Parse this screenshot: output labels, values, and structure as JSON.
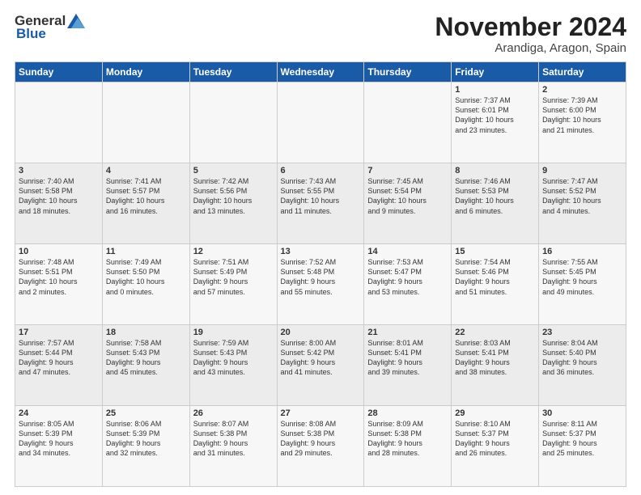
{
  "header": {
    "logo_general": "General",
    "logo_blue": "Blue",
    "month_title": "November 2024",
    "location": "Arandiga, Aragon, Spain"
  },
  "days_of_week": [
    "Sunday",
    "Monday",
    "Tuesday",
    "Wednesday",
    "Thursday",
    "Friday",
    "Saturday"
  ],
  "weeks": [
    [
      {
        "day": "",
        "info": ""
      },
      {
        "day": "",
        "info": ""
      },
      {
        "day": "",
        "info": ""
      },
      {
        "day": "",
        "info": ""
      },
      {
        "day": "",
        "info": ""
      },
      {
        "day": "1",
        "info": "Sunrise: 7:37 AM\nSunset: 6:01 PM\nDaylight: 10 hours\nand 23 minutes."
      },
      {
        "day": "2",
        "info": "Sunrise: 7:39 AM\nSunset: 6:00 PM\nDaylight: 10 hours\nand 21 minutes."
      }
    ],
    [
      {
        "day": "3",
        "info": "Sunrise: 7:40 AM\nSunset: 5:58 PM\nDaylight: 10 hours\nand 18 minutes."
      },
      {
        "day": "4",
        "info": "Sunrise: 7:41 AM\nSunset: 5:57 PM\nDaylight: 10 hours\nand 16 minutes."
      },
      {
        "day": "5",
        "info": "Sunrise: 7:42 AM\nSunset: 5:56 PM\nDaylight: 10 hours\nand 13 minutes."
      },
      {
        "day": "6",
        "info": "Sunrise: 7:43 AM\nSunset: 5:55 PM\nDaylight: 10 hours\nand 11 minutes."
      },
      {
        "day": "7",
        "info": "Sunrise: 7:45 AM\nSunset: 5:54 PM\nDaylight: 10 hours\nand 9 minutes."
      },
      {
        "day": "8",
        "info": "Sunrise: 7:46 AM\nSunset: 5:53 PM\nDaylight: 10 hours\nand 6 minutes."
      },
      {
        "day": "9",
        "info": "Sunrise: 7:47 AM\nSunset: 5:52 PM\nDaylight: 10 hours\nand 4 minutes."
      }
    ],
    [
      {
        "day": "10",
        "info": "Sunrise: 7:48 AM\nSunset: 5:51 PM\nDaylight: 10 hours\nand 2 minutes."
      },
      {
        "day": "11",
        "info": "Sunrise: 7:49 AM\nSunset: 5:50 PM\nDaylight: 10 hours\nand 0 minutes."
      },
      {
        "day": "12",
        "info": "Sunrise: 7:51 AM\nSunset: 5:49 PM\nDaylight: 9 hours\nand 57 minutes."
      },
      {
        "day": "13",
        "info": "Sunrise: 7:52 AM\nSunset: 5:48 PM\nDaylight: 9 hours\nand 55 minutes."
      },
      {
        "day": "14",
        "info": "Sunrise: 7:53 AM\nSunset: 5:47 PM\nDaylight: 9 hours\nand 53 minutes."
      },
      {
        "day": "15",
        "info": "Sunrise: 7:54 AM\nSunset: 5:46 PM\nDaylight: 9 hours\nand 51 minutes."
      },
      {
        "day": "16",
        "info": "Sunrise: 7:55 AM\nSunset: 5:45 PM\nDaylight: 9 hours\nand 49 minutes."
      }
    ],
    [
      {
        "day": "17",
        "info": "Sunrise: 7:57 AM\nSunset: 5:44 PM\nDaylight: 9 hours\nand 47 minutes."
      },
      {
        "day": "18",
        "info": "Sunrise: 7:58 AM\nSunset: 5:43 PM\nDaylight: 9 hours\nand 45 minutes."
      },
      {
        "day": "19",
        "info": "Sunrise: 7:59 AM\nSunset: 5:43 PM\nDaylight: 9 hours\nand 43 minutes."
      },
      {
        "day": "20",
        "info": "Sunrise: 8:00 AM\nSunset: 5:42 PM\nDaylight: 9 hours\nand 41 minutes."
      },
      {
        "day": "21",
        "info": "Sunrise: 8:01 AM\nSunset: 5:41 PM\nDaylight: 9 hours\nand 39 minutes."
      },
      {
        "day": "22",
        "info": "Sunrise: 8:03 AM\nSunset: 5:41 PM\nDaylight: 9 hours\nand 38 minutes."
      },
      {
        "day": "23",
        "info": "Sunrise: 8:04 AM\nSunset: 5:40 PM\nDaylight: 9 hours\nand 36 minutes."
      }
    ],
    [
      {
        "day": "24",
        "info": "Sunrise: 8:05 AM\nSunset: 5:39 PM\nDaylight: 9 hours\nand 34 minutes."
      },
      {
        "day": "25",
        "info": "Sunrise: 8:06 AM\nSunset: 5:39 PM\nDaylight: 9 hours\nand 32 minutes."
      },
      {
        "day": "26",
        "info": "Sunrise: 8:07 AM\nSunset: 5:38 PM\nDaylight: 9 hours\nand 31 minutes."
      },
      {
        "day": "27",
        "info": "Sunrise: 8:08 AM\nSunset: 5:38 PM\nDaylight: 9 hours\nand 29 minutes."
      },
      {
        "day": "28",
        "info": "Sunrise: 8:09 AM\nSunset: 5:38 PM\nDaylight: 9 hours\nand 28 minutes."
      },
      {
        "day": "29",
        "info": "Sunrise: 8:10 AM\nSunset: 5:37 PM\nDaylight: 9 hours\nand 26 minutes."
      },
      {
        "day": "30",
        "info": "Sunrise: 8:11 AM\nSunset: 5:37 PM\nDaylight: 9 hours\nand 25 minutes."
      }
    ]
  ]
}
